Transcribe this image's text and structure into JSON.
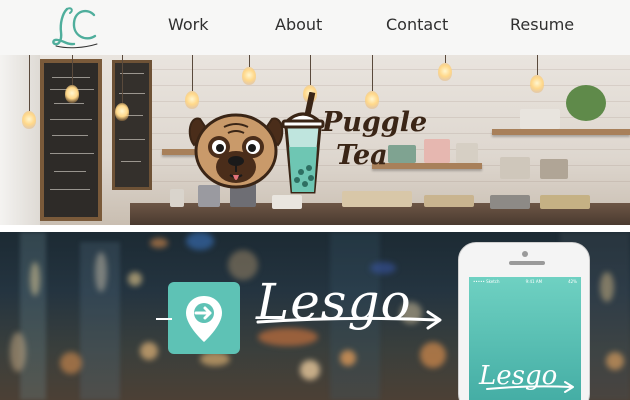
{
  "nav": {
    "logo_text": "LC",
    "items": [
      {
        "label": "Work"
      },
      {
        "label": "About"
      },
      {
        "label": "Contact"
      },
      {
        "label": "Resume"
      }
    ]
  },
  "projects": [
    {
      "name": "puggle-tea",
      "title_line1": "Puggle",
      "title_line2": "Tea"
    },
    {
      "name": "lesgo",
      "title": "Lesgo",
      "phone_status_left": "••••• Sketch",
      "phone_status_center": "9:41 AM",
      "phone_status_right": "42%"
    }
  ],
  "colors": {
    "nav_bg": "#f7f7f6",
    "logo_teal": "#4fae9c",
    "puggle_brown": "#3a2516",
    "lesgo_teal": "#5ec2b5"
  }
}
